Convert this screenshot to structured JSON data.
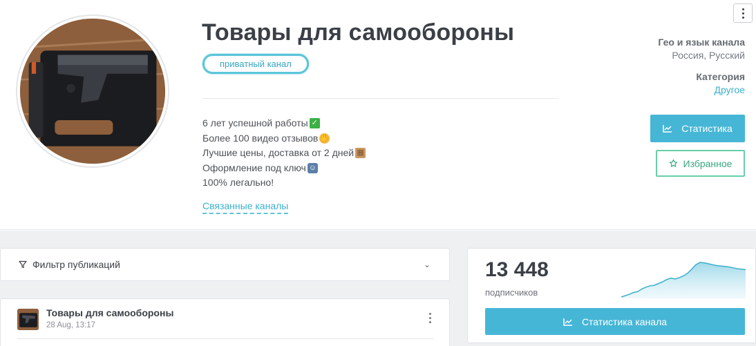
{
  "channel": {
    "title": "Товары для самообороны",
    "private_badge": "приватный канал",
    "description": [
      {
        "text": "6 лет успешной работы",
        "emoji": "check-emoji",
        "glyph": "✓"
      },
      {
        "text": "Более 100 видео отзывов",
        "emoji": "handshake-emoji",
        "glyph": "✋"
      },
      {
        "text": "Лучшие цены, доставка от 2 дней",
        "emoji": "package-emoji",
        "glyph": "▦"
      },
      {
        "text": "Оформление под ключ",
        "emoji": "police-officer-emoji",
        "glyph": "☺"
      },
      {
        "text": "100% легально!",
        "emoji": "",
        "glyph": ""
      }
    ],
    "related_link": "Связанные каналы"
  },
  "meta": {
    "geo_label": "Гео и язык канала",
    "geo_value": "Россия, Русский",
    "category_label": "Категория",
    "category_value": "Другое"
  },
  "actions": {
    "stats_label": "Статистика",
    "favorite_label": "Избранное"
  },
  "filter": {
    "label": "Фильтр публикаций",
    "chevron": "⌄"
  },
  "post": {
    "title": "Товары для самообороны",
    "date": "28 Aug, 13:17"
  },
  "subscribers": {
    "count": "13 448",
    "label": "подписчиков",
    "button_label": "Статистика канала",
    "trend": [
      2,
      5,
      8,
      12,
      14,
      20,
      24,
      27,
      28,
      32,
      36,
      41,
      44,
      42,
      45,
      49,
      55,
      64,
      74,
      79,
      78,
      76,
      74,
      72,
      71,
      70,
      69,
      67,
      65,
      64,
      63
    ]
  },
  "colors": {
    "accent": "#46b6d6",
    "favorite": "#38a87d",
    "link": "#3bb0c9"
  },
  "icons": {
    "more": "more-vertical-icon",
    "stats": "line-chart-icon",
    "favorite": "star-outline-icon",
    "filter": "filter-funnel-icon"
  }
}
